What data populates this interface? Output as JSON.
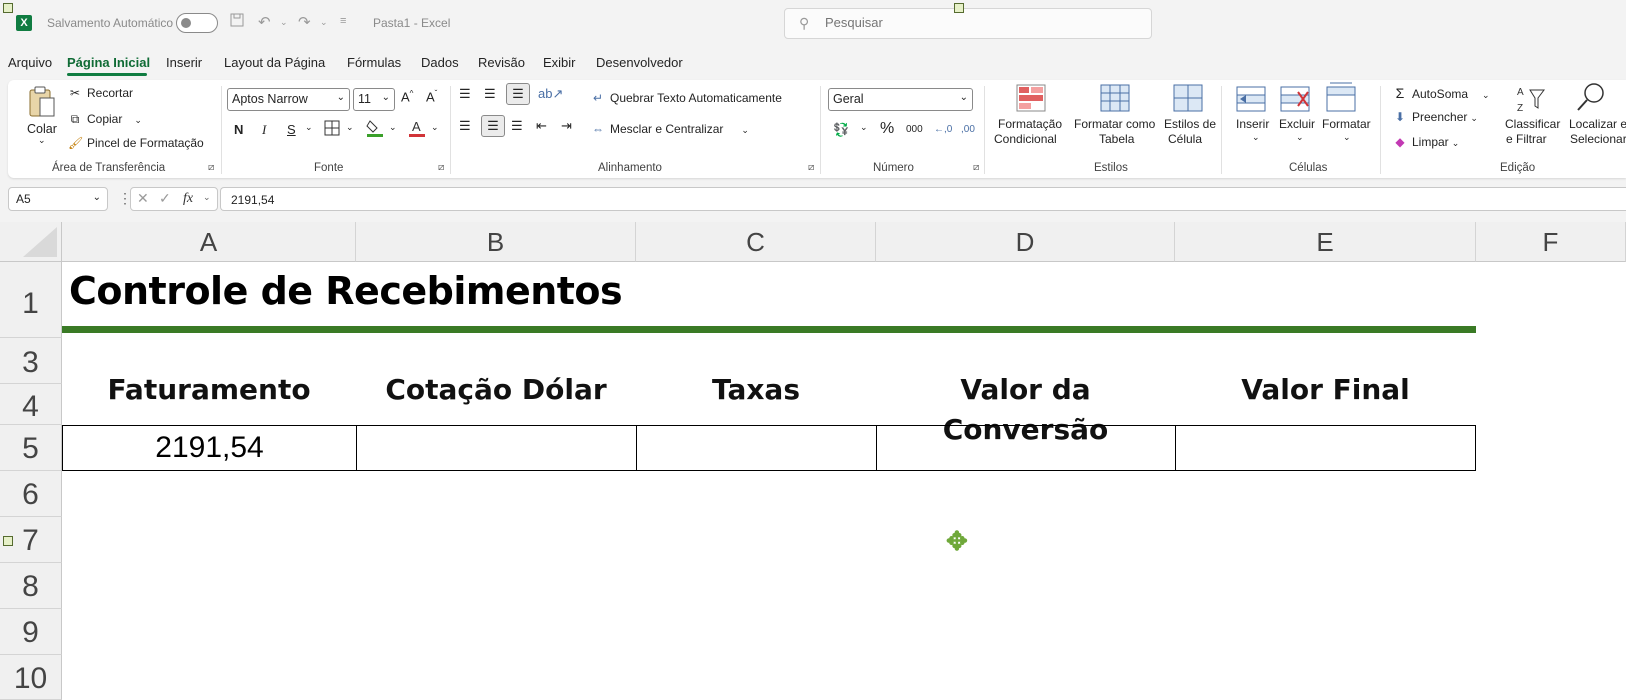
{
  "titlebar": {
    "app_icon": "excel-logo",
    "app_logo_letter": "X",
    "autosave_label": "Salvamento Automático",
    "file_title": "Pasta1  -  Excel",
    "search_placeholder": "Pesquisar"
  },
  "menu": {
    "tabs": [
      "Arquivo",
      "Página Inicial",
      "Inserir",
      "Layout da Página",
      "Fórmulas",
      "Dados",
      "Revisão",
      "Exibir",
      "Desenvolvedor"
    ],
    "active_tab": "Página Inicial"
  },
  "ribbon": {
    "clipboard": {
      "label": "Área de Transferência",
      "paste": "Colar",
      "cut": "Recortar",
      "copy": "Copiar",
      "format_painter": "Pincel de Formatação"
    },
    "font": {
      "label": "Fonte",
      "font_name": "Aptos Narrow",
      "font_size": "11",
      "bold": "N",
      "italic": "I",
      "underline": "S"
    },
    "alignment": {
      "label": "Alinhamento",
      "wrap_text": "Quebrar Texto Automaticamente",
      "merge_center": "Mesclar e Centralizar"
    },
    "number": {
      "label": "Número",
      "format": "Geral"
    },
    "styles": {
      "label": "Estilos",
      "conditional_line1": "Formatação",
      "conditional_line2": "Condicional",
      "table_line1": "Formatar como",
      "table_line2": "Tabela",
      "cell_styles_line1": "Estilos de",
      "cell_styles_line2": "Célula"
    },
    "cells": {
      "label": "Células",
      "insert": "Inserir",
      "delete": "Excluir",
      "format": "Formatar"
    },
    "editing": {
      "label": "Edição",
      "autosum": "AutoSoma",
      "fill": "Preencher",
      "clear": "Limpar",
      "sort_line1": "Classificar",
      "sort_line2": "e Filtrar",
      "find_line1": "Localizar e",
      "find_line2": "Selecionar"
    }
  },
  "formula_bar": {
    "name_box": "A5",
    "fx": "fx",
    "value": "2191,54"
  },
  "sheet": {
    "columns": [
      "A",
      "B",
      "C",
      "D",
      "E",
      "F"
    ],
    "rows": [
      "1",
      "3",
      "4",
      "5",
      "6",
      "7",
      "8",
      "9",
      "10"
    ],
    "title": "Controle de Recebimentos",
    "headers": [
      "Faturamento",
      "Cotação Dólar",
      "Taxas",
      "Valor da Conversão",
      "Valor Final"
    ],
    "data_row": [
      "2191,54",
      "",
      "",
      "",
      ""
    ],
    "accent_color": "#3a7a25"
  }
}
